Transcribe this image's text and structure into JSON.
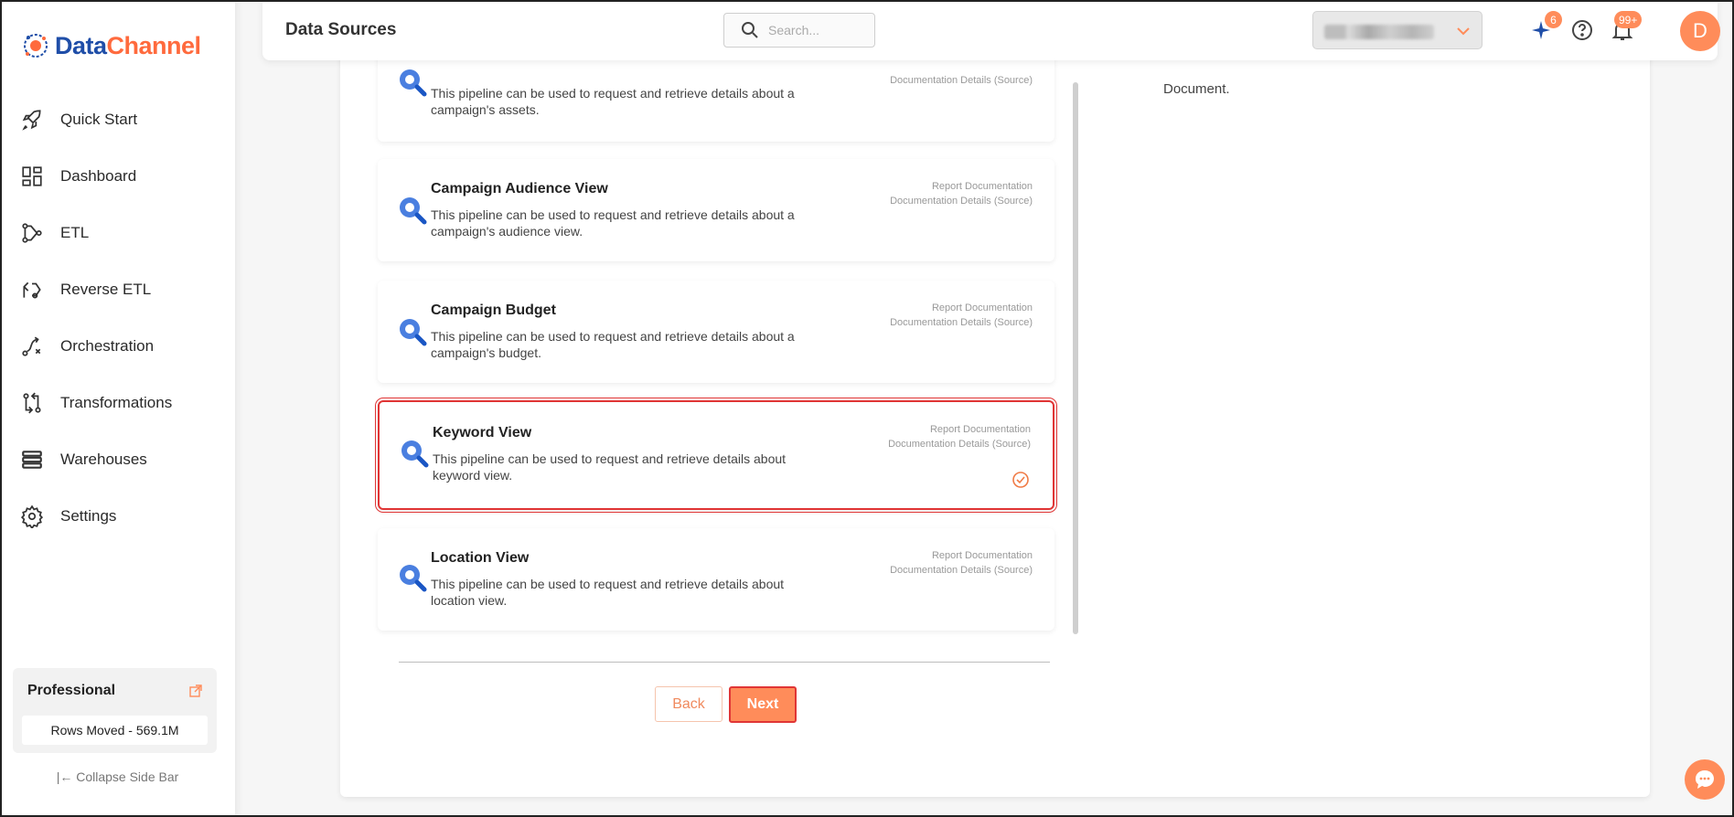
{
  "app": {
    "brand_left": "Data",
    "brand_right": "Channel"
  },
  "sidebar": {
    "items": [
      {
        "label": "Quick Start",
        "icon": "rocket-icon"
      },
      {
        "label": "Dashboard",
        "icon": "dashboard-icon"
      },
      {
        "label": "ETL",
        "icon": "etl-icon"
      },
      {
        "label": "Reverse ETL",
        "icon": "reverse-etl-icon"
      },
      {
        "label": "Orchestration",
        "icon": "orchestration-icon"
      },
      {
        "label": "Transformations",
        "icon": "transformations-icon"
      },
      {
        "label": "Warehouses",
        "icon": "warehouses-icon"
      },
      {
        "label": "Settings",
        "icon": "gear-icon"
      }
    ],
    "plan": {
      "name": "Professional",
      "rows_moved": "Rows Moved - 569.1M"
    },
    "collapse_label": "|← Collapse Side Bar"
  },
  "header": {
    "title": "Data Sources",
    "search_placeholder": "Search...",
    "sparkle_badge": "6",
    "notification_badge": "99+",
    "avatar_letter": "D"
  },
  "right_panel": {
    "text": "Document."
  },
  "pipelines": [
    {
      "title": "",
      "desc": "This pipeline can be used to request and retrieve details about a campaign's assets.",
      "link1": "",
      "link2": "Documentation Details (Source)",
      "selected": false
    },
    {
      "title": "Campaign Audience View",
      "desc": "This pipeline can be used to request and retrieve details about a campaign's audience view.",
      "link1": "Report Documentation",
      "link2": "Documentation Details (Source)",
      "selected": false
    },
    {
      "title": "Campaign Budget",
      "desc": "This pipeline can be used to request and retrieve details about a campaign's budget.",
      "link1": "Report Documentation",
      "link2": "Documentation Details (Source)",
      "selected": false
    },
    {
      "title": "Keyword View",
      "desc": "This pipeline can be used to request and retrieve details about keyword view.",
      "link1": "Report Documentation",
      "link2": "Documentation Details (Source)",
      "selected": true
    },
    {
      "title": "Location View",
      "desc": "This pipeline can be used to request and retrieve details about location view.",
      "link1": "Report Documentation",
      "link2": "Documentation Details (Source)",
      "selected": false
    }
  ],
  "actions": {
    "back": "Back",
    "next": "Next"
  },
  "colors": {
    "accent": "#ff8c5a",
    "brand_blue": "#1f4ea8",
    "selection_red": "#e03535"
  }
}
